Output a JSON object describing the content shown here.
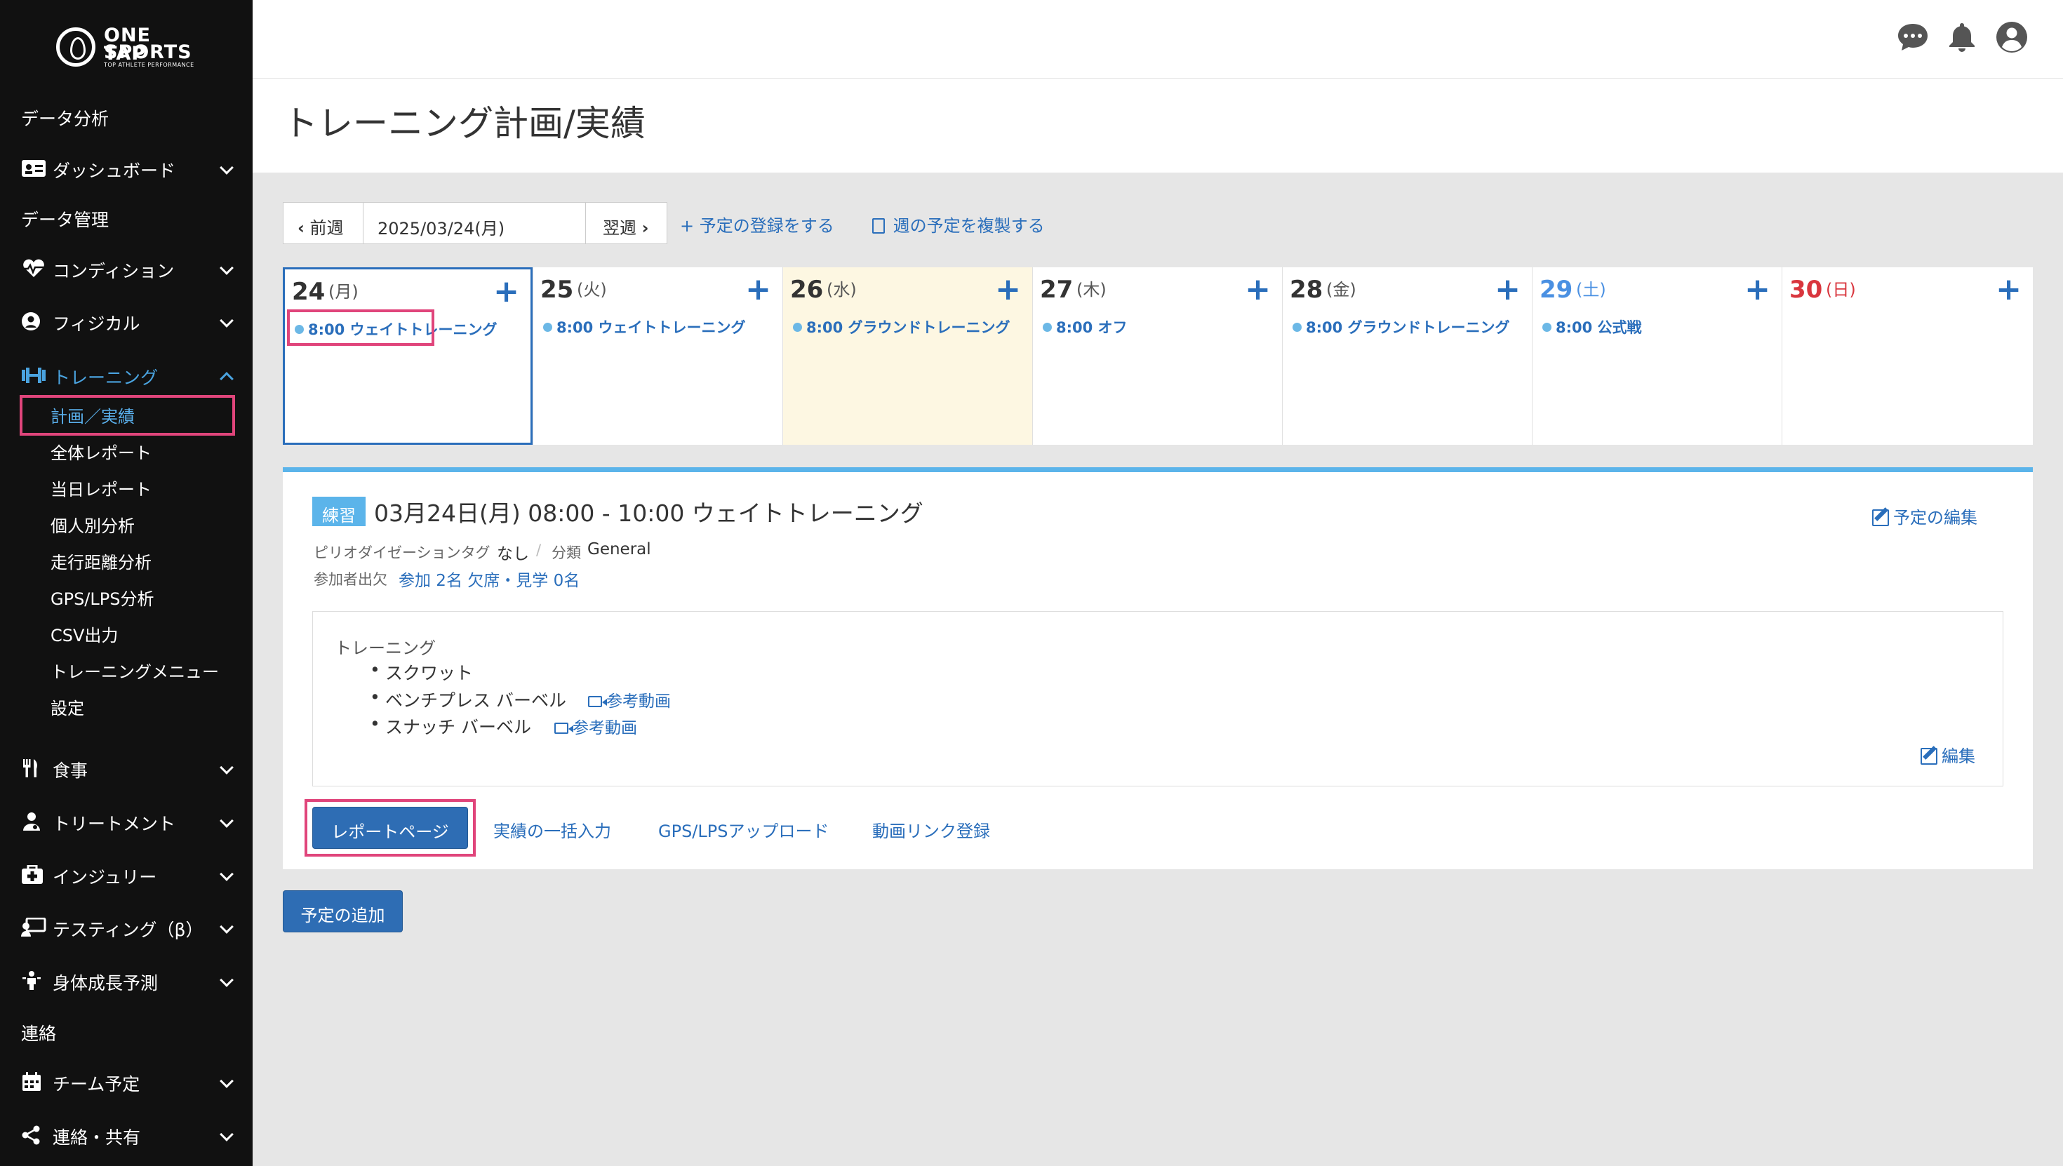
{
  "brand": {
    "line1": "ONE TAP",
    "line2": "SPORTS",
    "tagline": "TOP ATHLETE PERFORMANCE"
  },
  "sidebar": {
    "section_analysis": "データ分析",
    "dashboard": "ダッシュボード",
    "section_data": "データ管理",
    "condition": "コンディション",
    "physical": "フィジカル",
    "training": "トレーニング",
    "training_sub": [
      "計画／実績",
      "全体レポート",
      "当日レポート",
      "個人別分析",
      "走行距離分析",
      "GPS/LPS分析",
      "CSV出力",
      "トレーニングメニュー",
      "設定"
    ],
    "meal": "食事",
    "treatment": "トリートメント",
    "injury": "インジュリー",
    "testing": "テスティング（β）",
    "growth": "身体成長予測",
    "section_contact": "連絡",
    "team_schedule": "チーム予定",
    "share": "連絡・共有"
  },
  "header": {
    "title": "トレーニング計画/実績"
  },
  "toolbar": {
    "prev": "前週",
    "date": "2025/03/24(月)",
    "next": "翌週",
    "register": "予定の登録をする",
    "copy_week": "週の予定を複製する"
  },
  "calendar": {
    "days": [
      {
        "num": "24",
        "dow": "(月)",
        "event": "8:00 ウェイトトレーニング"
      },
      {
        "num": "25",
        "dow": "(火)",
        "event": "8:00 ウェイトトレーニング"
      },
      {
        "num": "26",
        "dow": "(水)",
        "event": "8:00 グラウンドトレーニング"
      },
      {
        "num": "27",
        "dow": "(木)",
        "event": "8:00 オフ"
      },
      {
        "num": "28",
        "dow": "(金)",
        "event": "8:00 グラウンドトレーニング"
      },
      {
        "num": "29",
        "dow": "(土)",
        "event": "8:00 公式戦"
      },
      {
        "num": "30",
        "dow": "(日)",
        "event": ""
      }
    ],
    "add_symbol": "+"
  },
  "detail": {
    "badge": "練習",
    "title": "03月24日(月) 08:00 - 10:00 ウェイトトレーニング",
    "edit_schedule": "予定の編集",
    "period_label": "ピリオダイゼーションタグ",
    "period_value": "なし",
    "separator": "/",
    "category_label": "分類",
    "category_value": "General",
    "attendance_label": "参加者出欠",
    "attendance_value": "参加 2名 欠席・見学 0名",
    "training_heading": "トレーニング",
    "items": [
      "スクワット",
      "ベンチプレス バーベル",
      "スナッチ バーベル"
    ],
    "ref_video": "参考動画",
    "edit": "編集"
  },
  "actions": {
    "report": "レポートページ",
    "bulk_input": "実績の一括入力",
    "gps_upload": "GPS/LPSアップロード",
    "video_link": "動画リンク登録",
    "add_schedule": "予定の追加"
  }
}
